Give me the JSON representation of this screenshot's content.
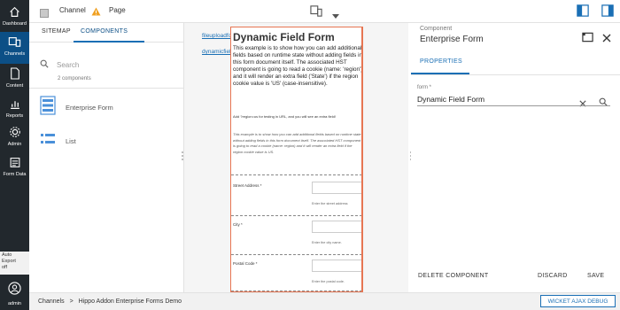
{
  "nav": {
    "items": [
      {
        "label": "Dashboard",
        "icon": "home-icon"
      },
      {
        "label": "Channels",
        "icon": "channels-icon",
        "active": true
      },
      {
        "label": "Content",
        "icon": "content-icon"
      },
      {
        "label": "Reports",
        "icon": "reports-icon"
      },
      {
        "label": "Admin",
        "icon": "gear-icon"
      },
      {
        "label": "Form Data",
        "icon": "form-data-icon"
      }
    ],
    "auto_export": {
      "line1": "Auto",
      "line2": "Export",
      "line3": "off"
    },
    "user_label": "admin"
  },
  "topbar": {
    "channel_label": "Channel",
    "page_label": "Page"
  },
  "left_panel": {
    "tabs": [
      "SITEMAP",
      "COMPONENTS"
    ],
    "active_tab": "COMPONENTS",
    "search_placeholder": "Search",
    "component_count": "2 components",
    "components": [
      {
        "name": "Enterprise Form",
        "icon": "form-icon"
      },
      {
        "name": "List",
        "icon": "list-icon"
      }
    ]
  },
  "canvas": {
    "links": [
      "afterprocessform",
      "fileuploadform",
      "dynamicfieldsformform"
    ],
    "form": {
      "title": "Dynamic Field Form",
      "intro": "This example is to show how you can add additional fields based on runtime state without adding fields in this form document itself. The associated HST component is going to read a cookie (name: 'region') and it will render an extra field ('State') if the region cookie value is 'US' (case-insensitive).",
      "note": "Add ?region=us for testing in URL, and you will see an extra field!",
      "italic_intro": "This example is to show how you can add additional fields based on runtime state without adding fields in this form document itself. The associated HST component is going to read a cookie (name: region) and it will render an extra field if the region cookie value is US.",
      "fields": [
        {
          "label": "Street Address *",
          "help": "Enter the street address"
        },
        {
          "label": "City *",
          "help": "Enter the city name."
        },
        {
          "label": "Postal Code *",
          "help": "Enter the postal code."
        }
      ]
    }
  },
  "right_panel": {
    "category": "Component",
    "title": "Enterprise Form",
    "tab": "PROPERTIES",
    "form_label": "form *",
    "form_value": "Dynamic Field Form",
    "buttons": {
      "delete": "DELETE COMPONENT",
      "discard": "DISCARD",
      "save": "SAVE"
    }
  },
  "footer": {
    "breadcrumb": [
      "Channels",
      ">",
      "Hippo Addon Enterprise Forms Demo"
    ],
    "wicket_label": "WICKET AJAX DEBUG"
  },
  "colors": {
    "nav_bg": "#22282d",
    "nav_active": "#0c4f86",
    "accent": "#1a6fb5",
    "frame_border": "#e77552",
    "warning": "#f0a020"
  }
}
